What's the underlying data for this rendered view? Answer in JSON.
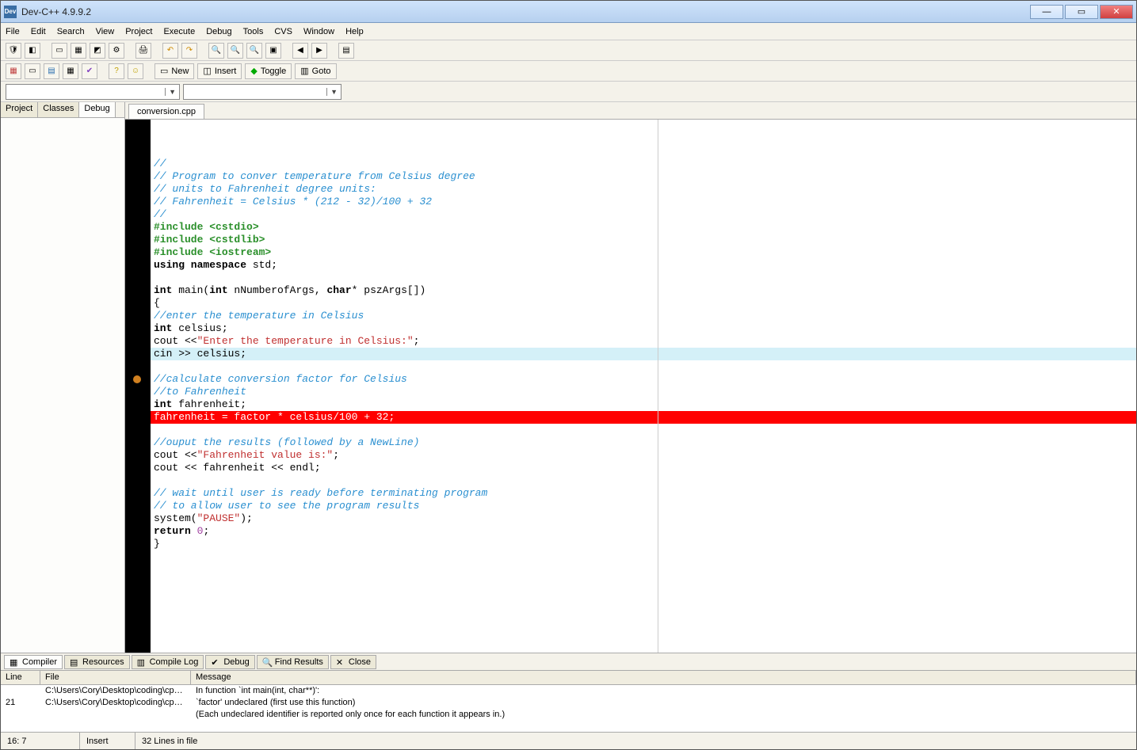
{
  "window": {
    "title": "Dev-C++ 4.9.9.2",
    "app_icon_text": "Dev"
  },
  "menus": [
    "File",
    "Edit",
    "Search",
    "View",
    "Project",
    "Execute",
    "Debug",
    "Tools",
    "CVS",
    "Window",
    "Help"
  ],
  "toolbar2_buttons": {
    "new": "New",
    "insert": "Insert",
    "toggle": "Toggle",
    "goto": "Goto"
  },
  "left_tabs": [
    "Project",
    "Classes",
    "Debug"
  ],
  "left_active_tab": "Debug",
  "editor_tab": "conversion.cpp",
  "code_lines": [
    {
      "t": "//",
      "c": "comment"
    },
    {
      "t": "// Program to conver temperature from Celsius degree",
      "c": "comment"
    },
    {
      "t": "// units to Fahrenheit degree units:",
      "c": "comment"
    },
    {
      "t": "// Fahrenheit = Celsius * (212 - 32)/100 + 32",
      "c": "comment"
    },
    {
      "t": "//",
      "c": "comment"
    },
    {
      "segs": [
        {
          "t": "#include ",
          "c": "pre"
        },
        {
          "t": "<cstdio>",
          "c": "pre"
        }
      ]
    },
    {
      "segs": [
        {
          "t": "#include ",
          "c": "pre"
        },
        {
          "t": "<cstdlib>",
          "c": "pre"
        }
      ]
    },
    {
      "segs": [
        {
          "t": "#include ",
          "c": "pre"
        },
        {
          "t": "<iostream>",
          "c": "pre"
        }
      ]
    },
    {
      "segs": [
        {
          "t": "using namespace",
          "c": "kw"
        },
        {
          "t": " std;",
          "c": ""
        }
      ]
    },
    {
      "t": "",
      "c": ""
    },
    {
      "segs": [
        {
          "t": "int",
          "c": "kw"
        },
        {
          "t": " main(",
          "c": ""
        },
        {
          "t": "int",
          "c": "kw"
        },
        {
          "t": " nNumberofArgs, ",
          "c": ""
        },
        {
          "t": "char",
          "c": "kw"
        },
        {
          "t": "* pszArgs[])",
          "c": ""
        }
      ]
    },
    {
      "t": "{",
      "c": ""
    },
    {
      "t": "//enter the temperature in Celsius",
      "c": "comment"
    },
    {
      "segs": [
        {
          "t": "int",
          "c": "kw"
        },
        {
          "t": " celsius;",
          "c": ""
        }
      ]
    },
    {
      "segs": [
        {
          "t": "cout <<",
          "c": ""
        },
        {
          "t": "\"Enter the temperature in Celsius:\"",
          "c": "str"
        },
        {
          "t": ";",
          "c": ""
        }
      ]
    },
    {
      "t": "cin >> celsius;",
      "c": "",
      "hl": "cyan"
    },
    {
      "t": "",
      "c": ""
    },
    {
      "t": "//calculate conversion factor for Celsius",
      "c": "comment"
    },
    {
      "t": "//to Fahrenheit",
      "c": "comment"
    },
    {
      "segs": [
        {
          "t": "int",
          "c": "kw"
        },
        {
          "t": " fahrenheit;",
          "c": ""
        }
      ]
    },
    {
      "t": "fahrenheit = factor * celsius/100 + 32;",
      "c": "",
      "hl": "red",
      "bp": true
    },
    {
      "t": "",
      "c": ""
    },
    {
      "t": "//ouput the results (followed by a NewLine)",
      "c": "comment"
    },
    {
      "segs": [
        {
          "t": "cout <<",
          "c": ""
        },
        {
          "t": "\"Fahrenheit value is:\"",
          "c": "str"
        },
        {
          "t": ";",
          "c": ""
        }
      ]
    },
    {
      "t": "cout << fahrenheit << endl;",
      "c": ""
    },
    {
      "t": "",
      "c": ""
    },
    {
      "t": "// wait until user is ready before terminating program",
      "c": "comment"
    },
    {
      "t": "// to allow user to see the program results",
      "c": "comment"
    },
    {
      "segs": [
        {
          "t": "system(",
          "c": ""
        },
        {
          "t": "\"PAUSE\"",
          "c": "str"
        },
        {
          "t": ");",
          "c": ""
        }
      ]
    },
    {
      "segs": [
        {
          "t": "return",
          "c": "kw"
        },
        {
          "t": " ",
          "c": ""
        },
        {
          "t": "0",
          "c": "num"
        },
        {
          "t": ";",
          "c": ""
        }
      ]
    },
    {
      "t": "}",
      "c": ""
    }
  ],
  "bottom_tabs": [
    "Compiler",
    "Resources",
    "Compile Log",
    "Debug",
    "Find Results",
    "Close"
  ],
  "compiler_cols": {
    "line": "Line",
    "file": "File",
    "msg": "Message"
  },
  "compiler_rows": [
    {
      "line": "",
      "file": "C:\\Users\\Cory\\Desktop\\coding\\cpp ...",
      "msg": "In function `int main(int, char**)':"
    },
    {
      "line": "21",
      "file": "C:\\Users\\Cory\\Desktop\\coding\\cpp ...",
      "msg": "`factor' undeclared (first use this function)"
    },
    {
      "line": "",
      "file": "",
      "msg": "(Each undeclared identifier is reported only once for each function it appears in.)"
    }
  ],
  "status": {
    "pos": "16: 7",
    "mode": "Insert",
    "lines": "32 Lines in file"
  }
}
